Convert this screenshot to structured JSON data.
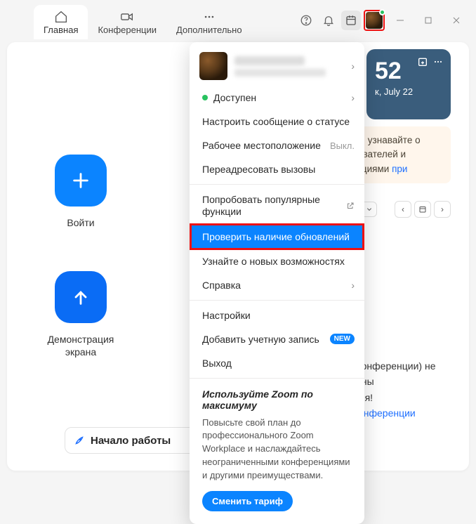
{
  "tabs": {
    "home": {
      "label": "Главная"
    },
    "meetings": {
      "label": "Конференции"
    },
    "more": {
      "label": "Дополнительно"
    }
  },
  "action_tiles": {
    "join": "Войти",
    "share": "Демонстрация экрана"
  },
  "calendar_card": {
    "time_suffix": "52",
    "date": "к, July 22"
  },
  "promo_box": {
    "line1": "я, узнавайте о",
    "line2": "ователей и",
    "line3": "кциями",
    "link": "при"
  },
  "empty_calendar": {
    "line1": "а (конференции) не",
    "line2": "ованы",
    "line3": "о дня!",
    "link": "е конференции"
  },
  "getting_started": "Начало работы",
  "panel": {
    "status": "Доступен",
    "set_status": "Настроить сообщение о статусе",
    "work_location": "Рабочее местоположение",
    "work_location_val": "Выкл.",
    "forward": "Переадресовать вызовы",
    "popular": "Попробовать популярные функции",
    "check_updates": "Проверить наличие обновлений",
    "whats_new": "Узнайте о новых возможностях",
    "help": "Справка",
    "settings": "Настройки",
    "add_account": "Добавить учетную запись",
    "new_badge": "NEW",
    "exit": "Выход",
    "foot_title": "Используйте Zoom по максимуму",
    "foot_body": "Повысьте свой план до профессионального Zoom Workplace и наслаждайтесь неограниченными конференциями и другими преимуществами.",
    "foot_btn": "Сменить тариф"
  }
}
